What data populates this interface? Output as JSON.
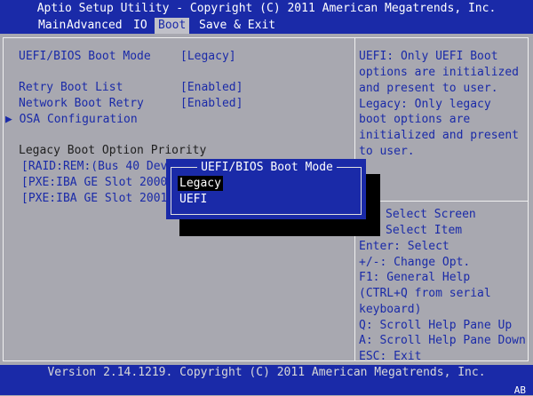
{
  "title": "Aptio Setup Utility - Copyright (C) 2011 American Megatrends, Inc.",
  "menu": [
    "Main",
    "Advanced",
    "IO",
    "Boot",
    "Save & Exit"
  ],
  "settings": {
    "boot_mode_label": "UEFI/BIOS Boot Mode",
    "boot_mode_value": "[Legacy]",
    "retry_boot_label": "Retry Boot List",
    "retry_boot_value": "[Enabled]",
    "network_retry_label": "Network Boot Retry",
    "network_retry_value": "[Enabled]",
    "osa_label": "OSA Configuration",
    "legacy_priority_label": "Legacy Boot Option Priority",
    "boot_entries": [
      "[RAID:REM:(Bus 40 Dev",
      "[PXE:IBA GE Slot 2000",
      "[PXE:IBA GE Slot 2001"
    ]
  },
  "help": [
    "UEFI: Only UEFI Boot",
    "options are initialized",
    "and present to user.",
    "Legacy: Only legacy",
    "boot options are",
    "initialized and present",
    "to user."
  ],
  "keys": [
    "Select Screen",
    "Select Item",
    "Enter: Select",
    "+/-: Change Opt.",
    "F1: General Help",
    "(CTRL+Q from serial",
    "keyboard)",
    "Q: Scroll Help Pane Up",
    "A: Scroll Help Pane Down",
    "ESC: Exit"
  ],
  "popup": {
    "title": "UEFI/BIOS Boot Mode",
    "options": [
      "Legacy",
      "UEFI"
    ],
    "selected": "Legacy"
  },
  "footer": {
    "version": "Version 2.14.1219. Copyright (C) 2011 American Megatrends, Inc.",
    "corner": "AB"
  },
  "colors": {
    "bios_blue": "#1a2aa8",
    "background_gray": "#a8a8b0",
    "highlight_black": "#000000"
  }
}
